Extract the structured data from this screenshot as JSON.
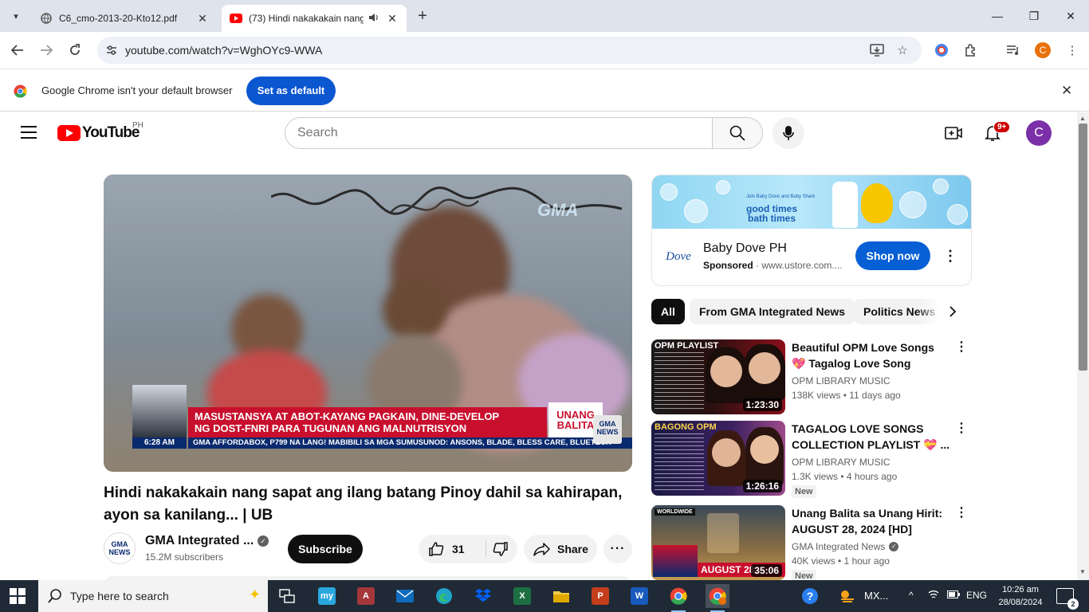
{
  "browser": {
    "tabs": [
      {
        "title": "C6_cmo-2013-20-Kto12.pdf",
        "active": false
      },
      {
        "title": "(73) Hindi nakakakain nang",
        "active": true
      }
    ],
    "url": "youtube.com/watch?v=WghOYc9-WWA",
    "profile_initial": "C",
    "infobar": {
      "message": "Google Chrome isn't your default browser",
      "button": "Set as default"
    }
  },
  "youtube": {
    "logo_word": "YouTube",
    "region": "PH",
    "search_placeholder": "Search",
    "notif_count": "9+",
    "avatar_initial": "C",
    "video": {
      "title": "Hindi nakakakain nang sapat ang ilang batang Pinoy dahil sa kahirapan, ayon sa kanilang... | UB",
      "overlay": {
        "bug": "GMA",
        "time": "6:28 AM",
        "headline_1": "MASUSTANSYA AT ABOT-KAYANG PAGKAIN, DINE-DEVELOP",
        "headline_2": "NG DOST-FNRI PARA TUGUNAN ANG MALNUTRISYON",
        "brand_1": "UNANG",
        "brand_2": "BALITA",
        "ticker": "GMA AFFORDABOX, P799 NA LANG! MABIBILI SA MGA SUMUSUNOD: ANSONS, BLADE, BLESS CARE, BLUETECH",
        "corner_1": "GMA",
        "corner_2": "NEWS"
      },
      "channel": {
        "logo_1": "GMA",
        "logo_2": "NEWS",
        "name": "GMA Integrated ...",
        "subs": "15.2M subscribers"
      },
      "subscribe": "Subscribe",
      "likes": "31",
      "share": "Share"
    },
    "ad": {
      "banner_small": "Join Baby Dove and Baby Shark",
      "banner_line1": "good times",
      "banner_line2": "bath times",
      "logo_text": "Dove",
      "name": "Baby Dove PH",
      "sponsored": "Sponsored",
      "domain": "www.ustore.com....",
      "cta": "Shop now"
    },
    "chips": [
      "All",
      "From GMA Integrated News",
      "Politics News"
    ],
    "recommendations": [
      {
        "thumb_label": "OPM PLAYLIST",
        "duration": "1:23:30",
        "title": "Beautiful OPM Love Songs 💖 Tagalog Love Song Collection...",
        "channel": "OPM LIBRARY MUSIC",
        "verified": false,
        "meta": "138K views  • 11 days ago",
        "badge": ""
      },
      {
        "thumb_label": "BAGONG OPM",
        "duration": "1:26:16",
        "title": "TAGALOG LOVE SONGS COLLECTION PLAYLIST 💝 ...",
        "channel": "OPM LIBRARY MUSIC",
        "verified": false,
        "meta": "1.3K views  • 4 hours ago",
        "badge": "New"
      },
      {
        "thumb_label": "WORLDWIDE",
        "thumb_bar": "AUGUST 28,",
        "duration": "35:06",
        "title": "Unang Balita sa Unang Hirit: AUGUST 28, 2024 [HD]",
        "channel": "GMA Integrated News",
        "verified": true,
        "meta": "40K views  • 1 hour ago",
        "badge": "New"
      }
    ]
  },
  "taskbar": {
    "search_placeholder": "Type here to search",
    "tray_app": "MX...",
    "lang": "ENG",
    "time": "10:26 am",
    "date": "28/08/2024",
    "notif_count": "2"
  }
}
